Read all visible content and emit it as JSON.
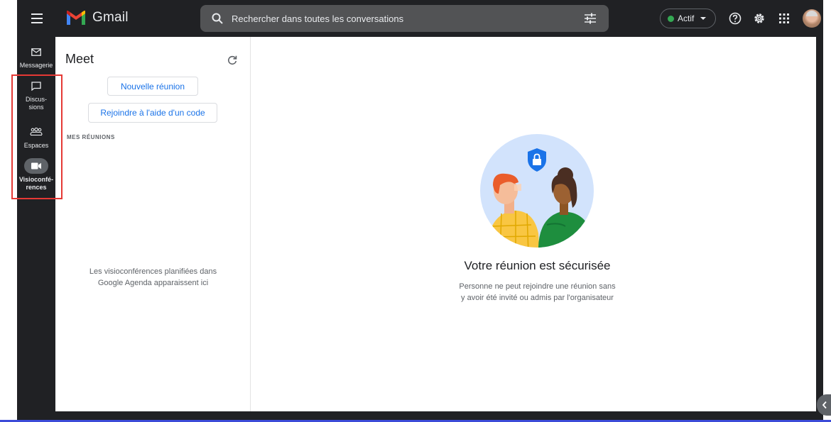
{
  "app": {
    "name": "Gmail"
  },
  "search": {
    "placeholder": "Rechercher dans toutes les conversations"
  },
  "status": {
    "label": "Actif",
    "color": "#34a853"
  },
  "rail": {
    "items": [
      {
        "label": "Messagerie",
        "icon": "mail-icon"
      },
      {
        "label": "Discus-\nsions",
        "icon": "chat-icon"
      },
      {
        "label": "Espaces",
        "icon": "spaces-icon"
      },
      {
        "label": "Visioconfé-\nrences",
        "icon": "video-camera-icon",
        "active": true
      }
    ]
  },
  "meet": {
    "title": "Meet",
    "new_meeting_label": "Nouvelle réunion",
    "join_label": "Rejoindre à l'aide d'un code",
    "section_label": "MES RÉUNIONS",
    "empty_text": "Les visioconférences planifiées dans Google Agenda apparaissent ici"
  },
  "main": {
    "title": "Votre réunion est sécurisée",
    "description": "Personne ne peut rejoindre une réunion sans y avoir été invité ou admis par l'organisateur"
  },
  "colors": {
    "accent": "#1a73e8",
    "highlight": "#e53935",
    "topbar": "#202124"
  }
}
